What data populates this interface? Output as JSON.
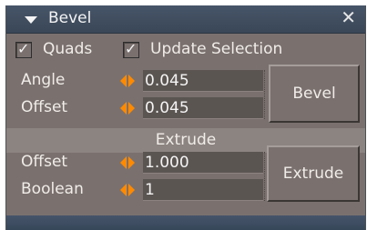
{
  "window": {
    "title": "Bevel"
  },
  "options": {
    "quads": {
      "label": "Quads",
      "checked": true
    },
    "update_selection": {
      "label": "Update Selection",
      "checked": true
    }
  },
  "bevel": {
    "angle": {
      "label": "Angle",
      "value": "0.045"
    },
    "offset": {
      "label": "Offset",
      "value": "0.045"
    },
    "button_label": "Bevel"
  },
  "extrude": {
    "section_label": "Extrude",
    "offset": {
      "label": "Offset",
      "value": "1.000"
    },
    "boolean": {
      "label": "Boolean",
      "value": "1"
    },
    "button_label": "Extrude"
  },
  "colors": {
    "panel": "#7a716f",
    "titlebar": "#475569",
    "field": "#5b5552",
    "spinner_accent": "#ff8a00"
  },
  "icons": [
    "collapse-triangle-icon",
    "close-icon",
    "checkmark-icon",
    "spinner-arrows-icon"
  ]
}
